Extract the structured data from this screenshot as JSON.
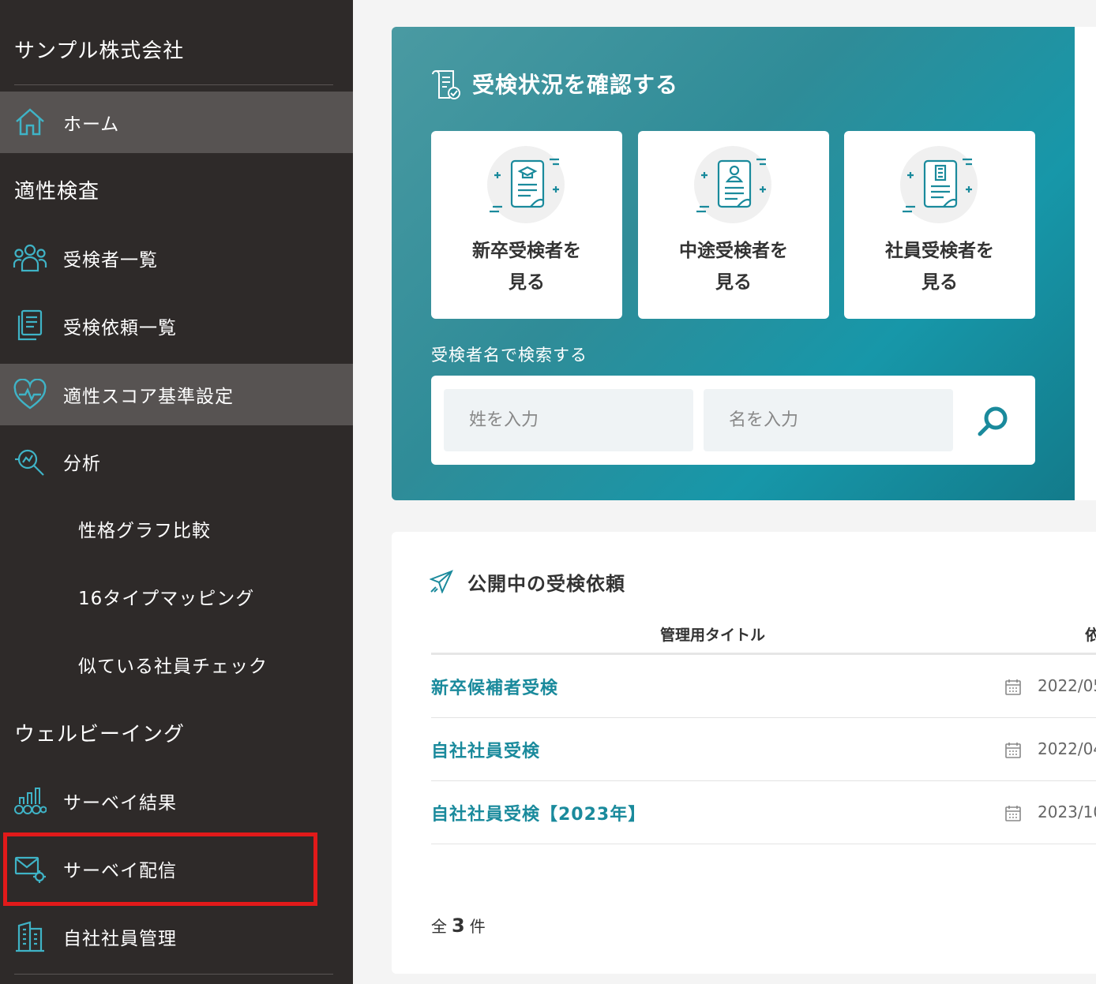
{
  "sidebar": {
    "company": "サンプル株式会社",
    "home": "ホーム",
    "section_aptitude": "適性検査",
    "examinees": "受検者一覧",
    "requests": "受検依頼一覧",
    "score_settings": "適性スコア基準設定",
    "analysis": "分析",
    "personality_compare": "性格グラフ比較",
    "type_mapping": "16タイプマッピング",
    "similar_employee": "似ている社員チェック",
    "section_wellbeing": "ウェルビーイング",
    "survey_results": "サーベイ結果",
    "survey_delivery": "サーベイ配信",
    "employee_mgmt": "自社社員管理"
  },
  "hero": {
    "title": "受検状況を確認する",
    "cards": [
      {
        "line1": "新卒受検者を",
        "line2": "見る",
        "icon": "graduate-doc-icon"
      },
      {
        "line1": "中途受検者を",
        "line2": "見る",
        "icon": "person-doc-icon"
      },
      {
        "line1": "社員受検者を",
        "line2": "見る",
        "icon": "building-doc-icon"
      }
    ],
    "search_label": "受検者名で検索する",
    "last_name_placeholder": "姓を入力",
    "first_name_placeholder": "名を入力"
  },
  "requests": {
    "title": "公開中の受検依頼",
    "col_title": "管理用タイトル",
    "col_date": "依",
    "rows": [
      {
        "title": "新卒候補者受検",
        "date": "2022/05"
      },
      {
        "title": "自社社員受検",
        "date": "2022/04"
      },
      {
        "title": "自社社員受検【2023年】",
        "date": "2023/10"
      }
    ],
    "total_prefix": "全",
    "total_count": "3",
    "total_suffix": "件"
  },
  "colors": {
    "sidebar_bg": "#2e2a29",
    "sidebar_active": "#575352",
    "accent": "#1a8a9c",
    "highlight": "#e11a1a"
  }
}
